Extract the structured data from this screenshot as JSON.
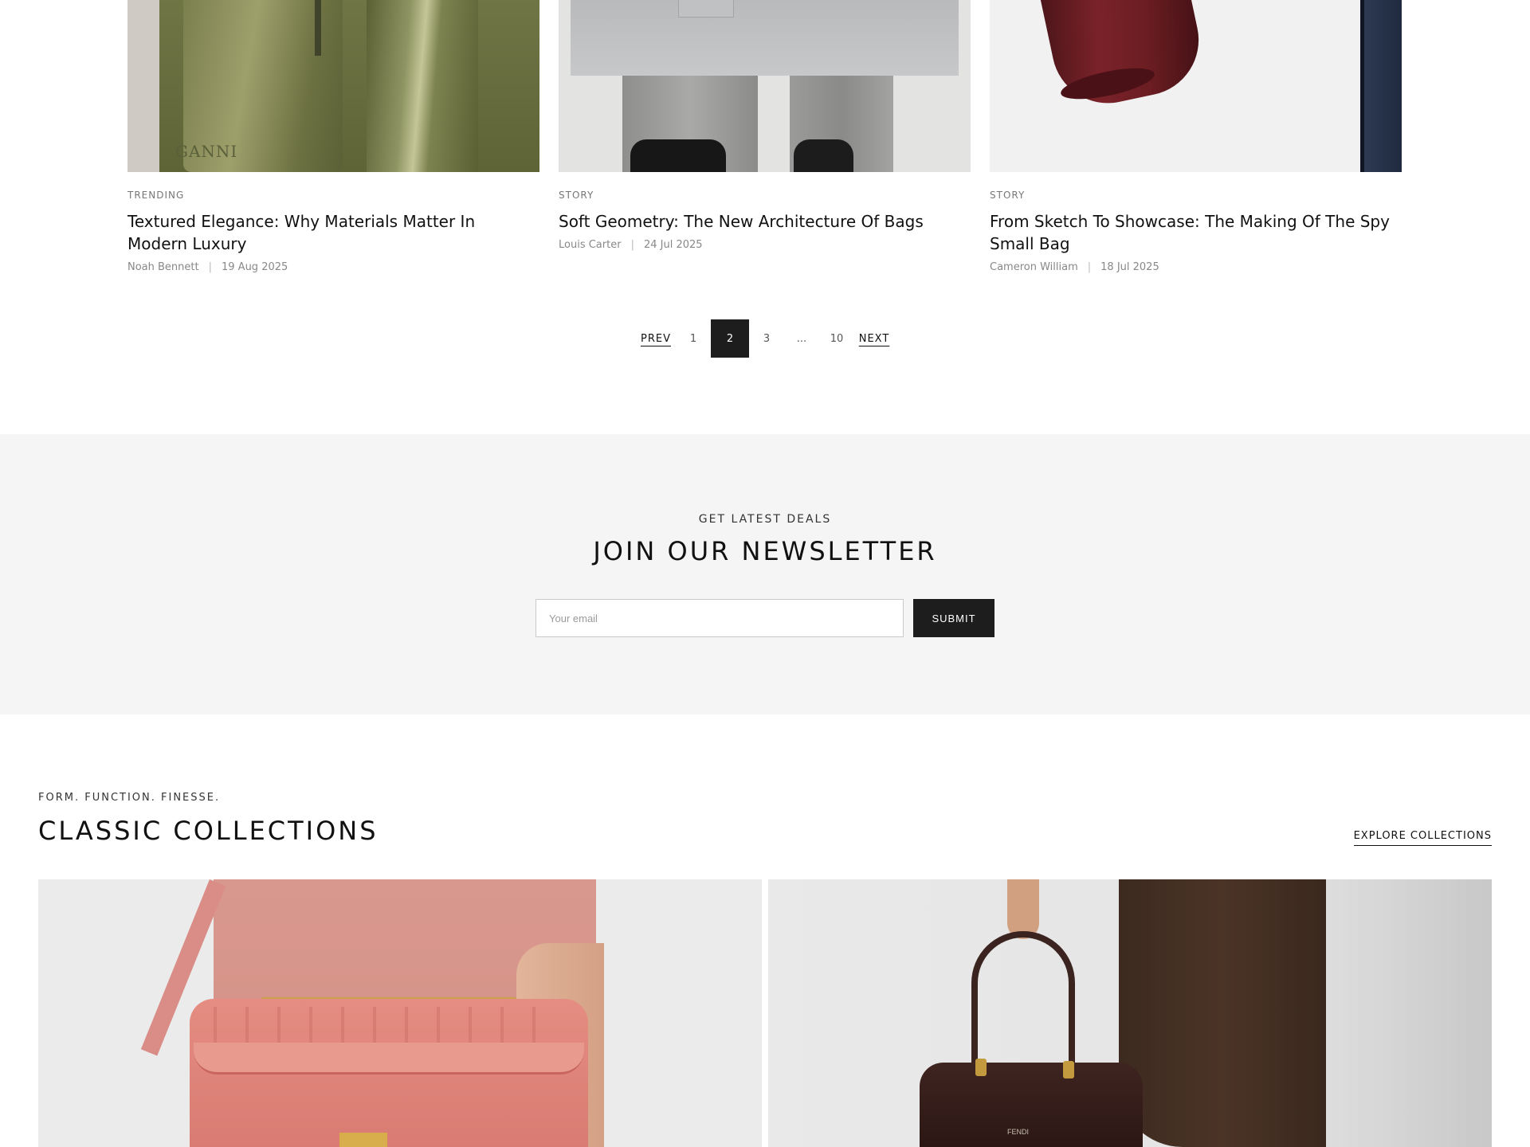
{
  "blog": {
    "cards": [
      {
        "tag": "TRENDING",
        "title": "Textured Elegance: Why Materials Matter In Modern Luxury",
        "author": "Noah Bennett",
        "date": "19 Aug 2025",
        "image_logo": "GANNI"
      },
      {
        "tag": "STORY",
        "title": "Soft Geometry: The New Architecture Of Bags",
        "author": "Louis Carter",
        "date": "24 Jul 2025"
      },
      {
        "tag": "STORY",
        "title": "From Sketch To Showcase: The Making Of The Spy Small Bag",
        "author": "Cameron William",
        "date": "18 Jul 2025"
      }
    ],
    "meta_separator": "|"
  },
  "pagination": {
    "prev": "PREV",
    "pages": [
      "1",
      "2",
      "3",
      "...",
      "10"
    ],
    "current": "2",
    "next": "NEXT"
  },
  "newsletter": {
    "eyebrow": "GET LATEST DEALS",
    "title": "JOIN OUR NEWSLETTER",
    "email_placeholder": "Your email",
    "submit_label": "SUBMIT",
    "bg_color": "#f5f5f5"
  },
  "collections": {
    "eyebrow": "FORM. FUNCTION. FINESSE.",
    "title": "CLASSIC COLLECTIONS",
    "explore_label": "EXPLORE COLLECTIONS",
    "items": [
      {
        "name": "pink-baguette-bag"
      },
      {
        "name": "brown-peekaboo-bag",
        "image_logo": "FENDI"
      }
    ]
  },
  "colors": {
    "primary_dark": "#1d1d1d",
    "text": "#111111",
    "muted": "#888888"
  }
}
